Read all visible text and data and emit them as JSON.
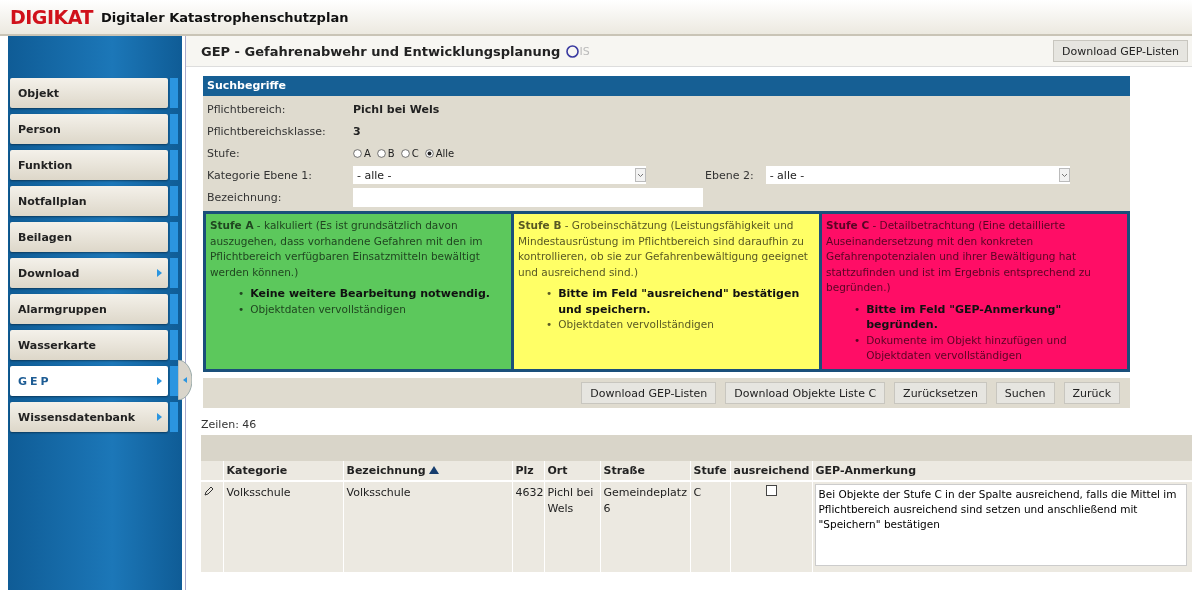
{
  "header": {
    "logo": "DIGIKAT",
    "title": "Digitaler Katastrophenschutzplan"
  },
  "sidebar": {
    "items": [
      {
        "label": "Objekt",
        "selected": false,
        "submenu": false
      },
      {
        "label": "Person",
        "selected": false,
        "submenu": false
      },
      {
        "label": "Funktion",
        "selected": false,
        "submenu": false
      },
      {
        "label": "Notfallplan",
        "selected": false,
        "submenu": false
      },
      {
        "label": "Beilagen",
        "selected": false,
        "submenu": false
      },
      {
        "label": "Download",
        "selected": false,
        "submenu": true
      },
      {
        "label": "Alarmgruppen",
        "selected": false,
        "submenu": false
      },
      {
        "label": "Wasserkarte",
        "selected": false,
        "submenu": false
      },
      {
        "label": "GEP",
        "selected": true,
        "submenu": true
      },
      {
        "label": "Wissensdatenbank",
        "selected": false,
        "submenu": true
      }
    ]
  },
  "page": {
    "title": "GEP - Gefahrenabwehr und Entwicklungsplanung",
    "logo_text": "IS",
    "top_button": "Download GEP-Listen"
  },
  "search": {
    "heading": "Suchbegriffe",
    "pflichtbereich": {
      "label": "Pflichtbereich:",
      "value": "Pichl bei Wels"
    },
    "klasse": {
      "label": "Pflichtbereichsklasse:",
      "value": "3"
    },
    "stufe": {
      "label": "Stufe:",
      "options": [
        {
          "label": "A",
          "selected": false
        },
        {
          "label": "B",
          "selected": false
        },
        {
          "label": "C",
          "selected": false
        },
        {
          "label": "Alle",
          "selected": true
        }
      ]
    },
    "kategorie": {
      "label": "Kategorie Ebene 1:",
      "value": "- alle -"
    },
    "ebene2": {
      "label": "Ebene 2:",
      "value": "- alle -"
    },
    "bezeichnung": {
      "label": "Bezeichnung:"
    }
  },
  "levels": [
    {
      "color": "#5cc85c",
      "text": "**Stufe A** - kalkuliert (Es ist grundsätzlich davon auszugehen, dass vorhandene Gefahren mit den im Pflichtbereich verfügbaren Einsatzmitteln bewältigt werden können.)",
      "bullets": [
        {
          "marker": "•",
          "text": "Keine weitere Bearbeitung notwendig.",
          "emphasis": true
        },
        {
          "marker": "•",
          "text": "Objektdaten vervollständigen",
          "emphasis": false
        }
      ]
    },
    {
      "color": "#ffff66",
      "text": "**Stufe B** - Grobeinschätzung (Leistungsfähigkeit und Mindestausrüstung im Pflichtbereich sind daraufhin zu kontrollieren, ob sie zur Gefahrenbewältigung geeignet und ausreichend sind.)",
      "bullets": [
        {
          "marker": "•",
          "text": "Bitte im Feld \"ausreichend\" bestätigen und speichern.",
          "emphasis": true
        },
        {
          "marker": "•",
          "text": "Objektdaten vervollständigen",
          "emphasis": false
        }
      ]
    },
    {
      "color": "#ff0d66",
      "text": "**Stufe C** - Detailbetrachtung (Eine detaillierte Auseinandersetzung mit den konkreten Gefahrenpotenzialen und ihrer Bewältigung hat stattzufinden und ist im Ergebnis entsprechend zu begründen.)",
      "bullets": [
        {
          "marker": "•",
          "text": "Bitte im Feld \"GEP-Anmerkung\" begründen.",
          "emphasis": true
        },
        {
          "marker": "•",
          "text": "Dokumente im Objekt hinzufügen und Objektdaten vervollständigen",
          "emphasis": false
        }
      ]
    }
  ],
  "buttons": [
    "Download GEP-Listen",
    "Download Objekte Liste C",
    "Zurücksetzen",
    "Suchen",
    "Zurück"
  ],
  "row_count": "Zeilen: 46",
  "table": {
    "columns": [
      {
        "label": "Kategorie",
        "sorted": false
      },
      {
        "label": "Bezeichnung",
        "sorted": true
      },
      {
        "label": "Plz",
        "sorted": false
      },
      {
        "label": "Ort",
        "sorted": false
      },
      {
        "label": "Straße",
        "sorted": false
      },
      {
        "label": "Stufe",
        "sorted": false
      },
      {
        "label": "ausreichend",
        "sorted": false
      },
      {
        "label": "GEP-Anmerkung",
        "sorted": false
      }
    ],
    "rows": [
      {
        "kategorie": "Volksschule",
        "bezeichnung": "Volksschule",
        "plz": "4632",
        "ort": "Pichl bei Wels",
        "strasse": "Gemeindeplatz 6",
        "stufe": "C",
        "ausreichend": false,
        "anmerkung": "Bei Objekte der Stufe C in der Spalte ausreichend, falls die Mittel im Pflichtbereich ausreichend sind setzen und anschließend mit \"Speichern\" bestätigen"
      }
    ]
  }
}
